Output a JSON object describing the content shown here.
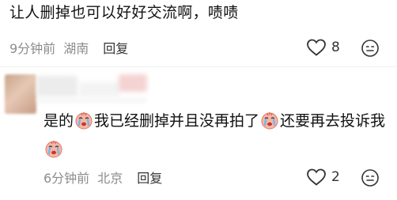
{
  "comment1": {
    "text": "让人删掉也可以好好交流啊，啧啧",
    "time": "9分钟前",
    "location": "湖南",
    "reply_label": "回复",
    "likes": "8"
  },
  "comment2": {
    "text_part1": "是的",
    "text_part2": "我已经删掉并且没再拍了",
    "text_part3": "还要再去投诉我",
    "emoji_name": "crying-face-icon",
    "time": "6分钟前",
    "location": "北京",
    "reply_label": "回复",
    "likes": "2"
  },
  "colors": {
    "meta": "#8c8c8c",
    "text": "#111111",
    "emoji": "#f2a2a0"
  }
}
